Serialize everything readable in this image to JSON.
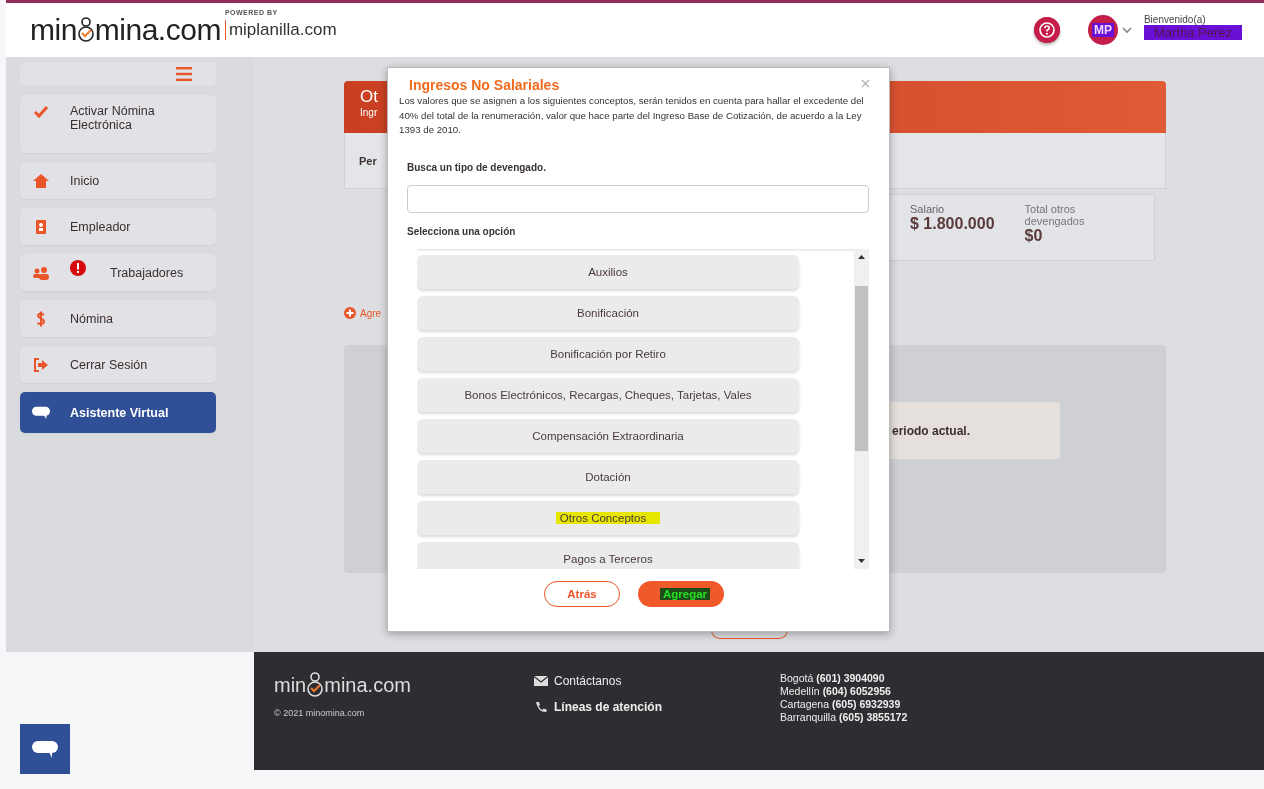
{
  "header": {
    "logo_left": "min",
    "logo_right": "mina.com",
    "powered_by": "POWERED BY",
    "partner": "miplanilla.com",
    "avatar_initials": "MP",
    "greeting": "Bienvenido(a)",
    "user_name": "Martha Perez"
  },
  "sidebar": {
    "items": [
      {
        "label": "Activar Nómina Electrónica",
        "kind": "check",
        "alert": false,
        "selected": false
      },
      {
        "label": "Inicio",
        "kind": "home",
        "alert": false,
        "selected": false
      },
      {
        "label": "Empleador",
        "kind": "badge",
        "alert": false,
        "selected": false
      },
      {
        "label": "Trabajadores",
        "kind": "people",
        "alert": true,
        "selected": false
      },
      {
        "label": "Nómina",
        "kind": "dollar",
        "alert": false,
        "selected": false
      },
      {
        "label": "Cerrar Sesión",
        "kind": "logout",
        "alert": false,
        "selected": false
      },
      {
        "label": "Asistente Virtual",
        "kind": "chat",
        "alert": false,
        "selected": true
      }
    ]
  },
  "background": {
    "card_title": "Ot",
    "card_subtitle": "Ingr",
    "period_label": "Per",
    "salary_label": "Salario",
    "salary_value": "$ 1.800.000",
    "total_label": "Total otros devengados",
    "total_value": "$0",
    "add_link": "Agre",
    "notice": "eriodo actual."
  },
  "modal": {
    "title": "Ingresos No Salariales",
    "description": "Los valores que se asignen a los siguientes conceptos, serán tenidos en cuenta para hallar el excedente del 40% del total de la renumeración, valor que hace parte del Ingreso Base de Cotización, de acuerdo a la Ley 1393 de 2010.",
    "search_label": "Busca un tipo de devengado.",
    "options_label": "Selecciona una opción",
    "options": [
      {
        "label": "Auxilios",
        "selected": false
      },
      {
        "label": "Bonificación",
        "selected": false
      },
      {
        "label": "Bonificación por Retiro",
        "selected": false
      },
      {
        "label": "Bonos Electrónicos, Recargas, Cheques, Tarjetas, Vales",
        "selected": false
      },
      {
        "label": "Compensación Extraordinaria",
        "selected": false
      },
      {
        "label": "Dotación",
        "selected": false
      },
      {
        "label": "Otros Conceptos",
        "selected": true
      },
      {
        "label": "Pagos a Terceros",
        "selected": false
      }
    ],
    "buttons": [
      {
        "label": "Atrás",
        "kind": "secondary"
      },
      {
        "label": "Agregar",
        "kind": "primary"
      }
    ]
  },
  "footer": {
    "logo_left": "min",
    "logo_right": "mina.com",
    "copyright": "© 2021 minomina.com",
    "contact": "Contáctanos",
    "lines": "Líneas de atención",
    "phones": [
      {
        "city": "Bogotá",
        "number": "(601) 3904090"
      },
      {
        "city": "Medellín",
        "number": "(604) 6052956"
      },
      {
        "city": "Cartagena",
        "number": "(605) 6932939"
      },
      {
        "city": "Barranquilla",
        "number": "(605) 3855172"
      }
    ]
  }
}
